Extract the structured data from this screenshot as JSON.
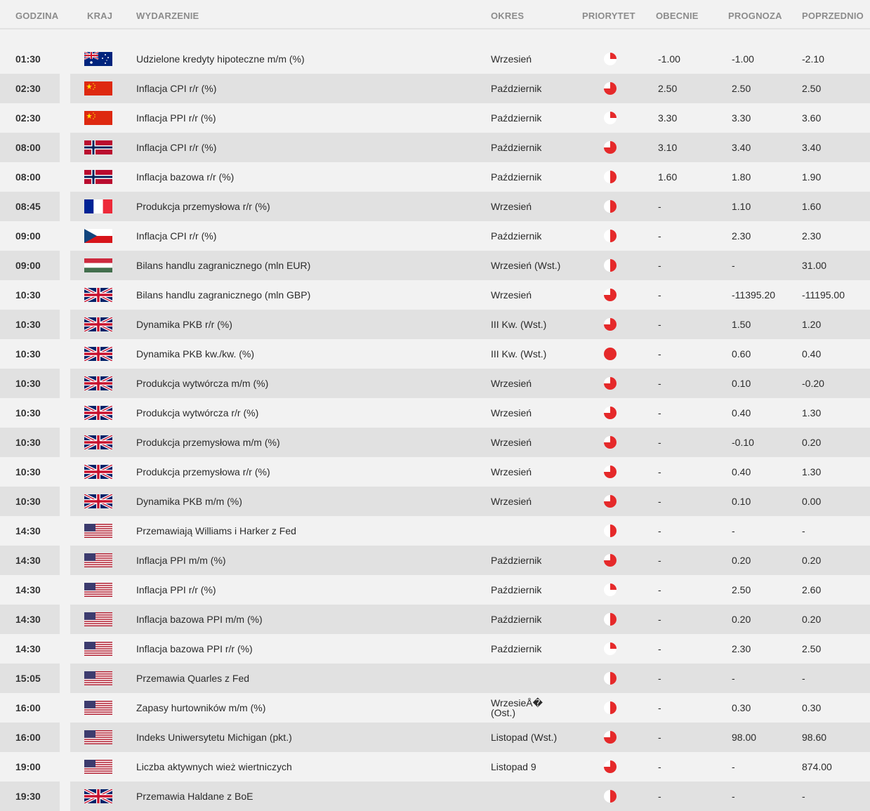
{
  "header": {
    "godzina": "GODZINA",
    "kraj": "KRAJ",
    "wydarzenie": "WYDARZENIE",
    "okres": "OKRES",
    "priorytet": "PRIORYTET",
    "obecnie": "OBECNIE",
    "prognoza": "PROGNOZA",
    "poprzednio": "POPRZEDNIO"
  },
  "colors": {
    "priority_red": "#e5292a",
    "row_alt": "#e1e1e1",
    "bg": "#f2f2f2"
  },
  "rows": [
    {
      "time": "01:30",
      "country": "au",
      "event": "Udzielone kredyty hipoteczne m/m (%)",
      "period": "Wrzesień",
      "priority": "low",
      "actual": "-1.00",
      "forecast": "-1.00",
      "previous": "-2.10"
    },
    {
      "time": "02:30",
      "country": "cn",
      "event": "Inflacja CPI r/r (%)",
      "period": "Październik",
      "priority": "high",
      "actual": "2.50",
      "forecast": "2.50",
      "previous": "2.50"
    },
    {
      "time": "02:30",
      "country": "cn",
      "event": "Inflacja PPI r/r (%)",
      "period": "Październik",
      "priority": "low",
      "actual": "3.30",
      "forecast": "3.30",
      "previous": "3.60"
    },
    {
      "time": "08:00",
      "country": "no",
      "event": "Inflacja CPI r/r (%)",
      "period": "Październik",
      "priority": "high",
      "actual": "3.10",
      "forecast": "3.40",
      "previous": "3.40"
    },
    {
      "time": "08:00",
      "country": "no",
      "event": "Inflacja bazowa r/r (%)",
      "period": "Październik",
      "priority": "medium",
      "actual": "1.60",
      "forecast": "1.80",
      "previous": "1.90"
    },
    {
      "time": "08:45",
      "country": "fr",
      "event": "Produkcja przemysłowa r/r (%)",
      "period": "Wrzesień",
      "priority": "medium",
      "actual": "-",
      "forecast": "1.10",
      "previous": "1.60"
    },
    {
      "time": "09:00",
      "country": "cz",
      "event": "Inflacja CPI r/r (%)",
      "period": "Październik",
      "priority": "medium",
      "actual": "-",
      "forecast": "2.30",
      "previous": "2.30"
    },
    {
      "time": "09:00",
      "country": "hu",
      "event": "Bilans handlu zagranicznego (mln EUR)",
      "period": "Wrzesień (Wst.)",
      "priority": "medium",
      "actual": "-",
      "forecast": "-",
      "previous": "31.00"
    },
    {
      "time": "10:30",
      "country": "gb",
      "event": "Bilans handlu zagranicznego (mln GBP)",
      "period": "Wrzesień",
      "priority": "high",
      "actual": "-",
      "forecast": "-11395.20",
      "previous": "-11195.00"
    },
    {
      "time": "10:30",
      "country": "gb",
      "event": "Dynamika PKB r/r (%)",
      "period": "III Kw. (Wst.)",
      "priority": "high",
      "actual": "-",
      "forecast": "1.50",
      "previous": "1.20"
    },
    {
      "time": "10:30",
      "country": "gb",
      "event": "Dynamika PKB kw./kw. (%)",
      "period": "III Kw. (Wst.)",
      "priority": "full",
      "actual": "-",
      "forecast": "0.60",
      "previous": "0.40"
    },
    {
      "time": "10:30",
      "country": "gb",
      "event": "Produkcja wytwórcza m/m (%)",
      "period": "Wrzesień",
      "priority": "high",
      "actual": "-",
      "forecast": "0.10",
      "previous": "-0.20"
    },
    {
      "time": "10:30",
      "country": "gb",
      "event": "Produkcja wytwórcza r/r (%)",
      "period": "Wrzesień",
      "priority": "high",
      "actual": "-",
      "forecast": "0.40",
      "previous": "1.30"
    },
    {
      "time": "10:30",
      "country": "gb",
      "event": "Produkcja przemysłowa m/m (%)",
      "period": "Wrzesień",
      "priority": "high",
      "actual": "-",
      "forecast": "-0.10",
      "previous": "0.20"
    },
    {
      "time": "10:30",
      "country": "gb",
      "event": "Produkcja przemysłowa r/r (%)",
      "period": "Wrzesień",
      "priority": "high",
      "actual": "-",
      "forecast": "0.40",
      "previous": "1.30"
    },
    {
      "time": "10:30",
      "country": "gb",
      "event": "Dynamika PKB m/m (%)",
      "period": "Wrzesień",
      "priority": "high",
      "actual": "-",
      "forecast": "0.10",
      "previous": "0.00"
    },
    {
      "time": "14:30",
      "country": "us",
      "event": "Przemawiają Williams i Harker z Fed",
      "period": "",
      "priority": "medium",
      "actual": "-",
      "forecast": "-",
      "previous": "-"
    },
    {
      "time": "14:30",
      "country": "us",
      "event": "Inflacja PPI m/m (%)",
      "period": "Październik",
      "priority": "high",
      "actual": "-",
      "forecast": "0.20",
      "previous": "0.20"
    },
    {
      "time": "14:30",
      "country": "us",
      "event": "Inflacja PPI r/r (%)",
      "period": "Październik",
      "priority": "low",
      "actual": "-",
      "forecast": "2.50",
      "previous": "2.60"
    },
    {
      "time": "14:30",
      "country": "us",
      "event": "Inflacja bazowa PPI m/m (%)",
      "period": "Październik",
      "priority": "medium",
      "actual": "-",
      "forecast": "0.20",
      "previous": "0.20"
    },
    {
      "time": "14:30",
      "country": "us",
      "event": "Inflacja bazowa PPI r/r (%)",
      "period": "Październik",
      "priority": "low",
      "actual": "-",
      "forecast": "2.30",
      "previous": "2.50"
    },
    {
      "time": "15:05",
      "country": "us",
      "event": "Przemawia Quarles z Fed",
      "period": "",
      "priority": "medium",
      "actual": "-",
      "forecast": "-",
      "previous": "-"
    },
    {
      "time": "16:00",
      "country": "us",
      "event": "Zapasy hurtowników m/m (%)",
      "period": "WrzesieÅ� (Ost.)",
      "priority": "medium",
      "actual": "-",
      "forecast": "0.30",
      "previous": "0.30"
    },
    {
      "time": "16:00",
      "country": "us",
      "event": "Indeks Uniwersytetu Michigan (pkt.)",
      "period": "Listopad (Wst.)",
      "priority": "high",
      "actual": "-",
      "forecast": "98.00",
      "previous": "98.60"
    },
    {
      "time": "19:00",
      "country": "us",
      "event": "Liczba aktywnych wież wiertniczych",
      "period": "Listopad 9",
      "priority": "high",
      "actual": "-",
      "forecast": "-",
      "previous": "874.00"
    },
    {
      "time": "19:30",
      "country": "gb",
      "event": "Przemawia Haldane z BoE",
      "period": "",
      "priority": "medium",
      "actual": "-",
      "forecast": "-",
      "previous": "-"
    }
  ]
}
